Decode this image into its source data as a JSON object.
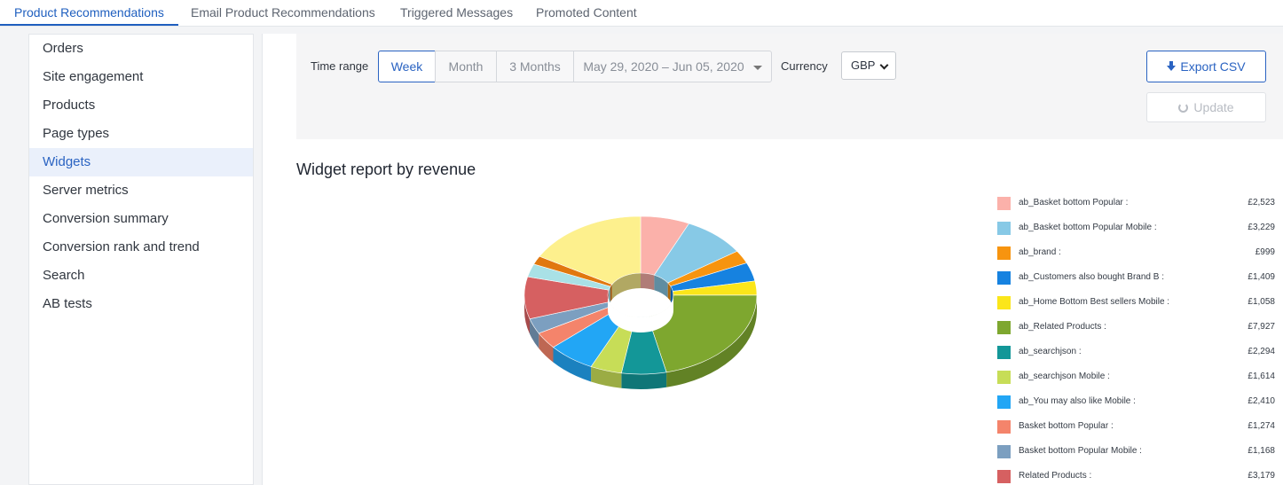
{
  "tabs": [
    {
      "label": "Product Recommendations",
      "active": true
    },
    {
      "label": "Email Product Recommendations",
      "active": false
    },
    {
      "label": "Triggered Messages",
      "active": false
    },
    {
      "label": "Promoted Content",
      "active": false
    }
  ],
  "sidebar": {
    "items": [
      {
        "label": "Orders"
      },
      {
        "label": "Site engagement"
      },
      {
        "label": "Products"
      },
      {
        "label": "Page types"
      },
      {
        "label": "Widgets",
        "active": true
      },
      {
        "label": "Server metrics"
      },
      {
        "label": "Conversion summary"
      },
      {
        "label": "Conversion rank and trend"
      },
      {
        "label": "Search"
      },
      {
        "label": "AB tests"
      }
    ]
  },
  "filters": {
    "time_range_label": "Time range",
    "ranges": [
      "Week",
      "Month",
      "3 Months"
    ],
    "active_range": "Week",
    "date_range": "May 29, 2020 – Jun 05, 2020",
    "currency_label": "Currency",
    "currency_value": "GBP",
    "export_label": "Export CSV",
    "update_label": "Update"
  },
  "report": {
    "title": "Widget report by revenue"
  },
  "chart_data": {
    "type": "pie",
    "donut": true,
    "three_d": true,
    "title": "Widget report by revenue",
    "legend_position": "right",
    "series": [
      {
        "name": "ab_Basket bottom Popular :",
        "display": "£2,523",
        "value": 2523,
        "color": "#fbb1aa"
      },
      {
        "name": "ab_Basket bottom Popular Mobile :",
        "display": "£3,229",
        "value": 3229,
        "color": "#87c9e6"
      },
      {
        "name": "ab_brand :",
        "display": "£999",
        "value": 999,
        "color": "#f7940f"
      },
      {
        "name": "ab_Customers also bought Brand B :",
        "display": "£1,409",
        "value": 1409,
        "color": "#1682e0"
      },
      {
        "name": "ab_Home Bottom Best sellers Mobile :",
        "display": "£1,058",
        "value": 1058,
        "color": "#fbe61a"
      },
      {
        "name": "ab_Related Products :",
        "display": "£7,927",
        "value": 7927,
        "color": "#7ea72f"
      },
      {
        "name": "ab_searchjson :",
        "display": "£2,294",
        "value": 2294,
        "color": "#139798"
      },
      {
        "name": "ab_searchjson Mobile :",
        "display": "£1,614",
        "value": 1614,
        "color": "#c7dd57"
      },
      {
        "name": "ab_You may also like Mobile :",
        "display": "£2,410",
        "value": 2410,
        "color": "#22a6f5"
      },
      {
        "name": "Basket bottom Popular :",
        "display": "£1,274",
        "value": 1274,
        "color": "#f4846b"
      },
      {
        "name": "Basket bottom Popular Mobile :",
        "display": "£1,168",
        "value": 1168,
        "color": "#7c9fc0"
      },
      {
        "name": "Related Products :",
        "display": "£3,179",
        "value": 3179,
        "color": "#d66061"
      },
      {
        "value": 990,
        "color": "#a9e1e6"
      },
      {
        "value": 650,
        "color": "#e1780f"
      },
      {
        "value": 6200,
        "color": "#fdf08d"
      }
    ]
  }
}
